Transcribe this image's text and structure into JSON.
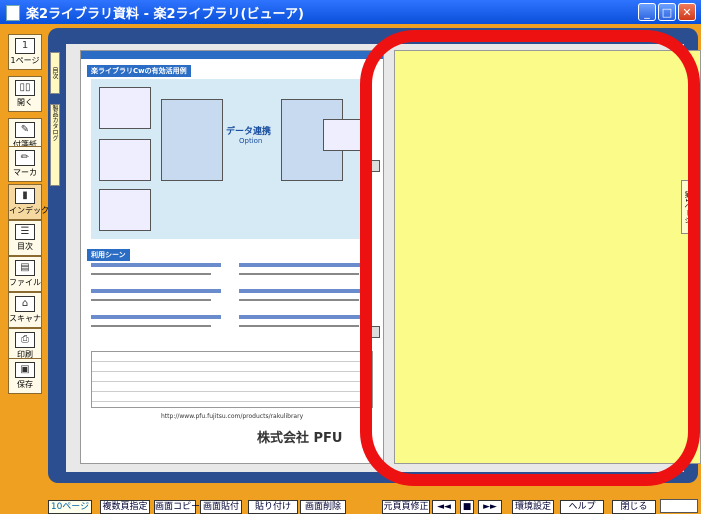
{
  "window": {
    "title": "楽2ライブラリ資料 - 楽2ライブラリ(ビューア)"
  },
  "left_tools": [
    {
      "label": "1ページ"
    },
    {
      "label": "開く"
    },
    {
      "label": "付箋紙"
    },
    {
      "label": "マーカ"
    },
    {
      "label": "インデックス"
    },
    {
      "label": "目次"
    },
    {
      "label": "ファイル"
    },
    {
      "label": "スキャナ"
    },
    {
      "label": "印刷"
    },
    {
      "label": "保存"
    }
  ],
  "left_page": {
    "section_title": "楽ライブラリCwの有効活用例",
    "diagram_caption": "データ連携",
    "diagram_sub": "Option",
    "section2_title": "利用シーン",
    "company": "株式会社 PFU",
    "url": "http://www.pfu.fujitsu.com/products/rakulibrary"
  },
  "bookmarks": {
    "top": "目次",
    "middle": "製品カタログ",
    "right": "第1ページ"
  },
  "bottom_bar": {
    "page_label": "10ページ",
    "buttons": [
      "複数頁指定",
      "画面コピー",
      "画面貼付",
      "貼り付け",
      "画面削除"
    ],
    "edit_label": "元頁頁修正",
    "nav_prev": "◄◄",
    "nav_stop": "■",
    "nav_next": "►►",
    "settings": "環境設定",
    "help": "ヘルプ",
    "close": "閉じる"
  }
}
